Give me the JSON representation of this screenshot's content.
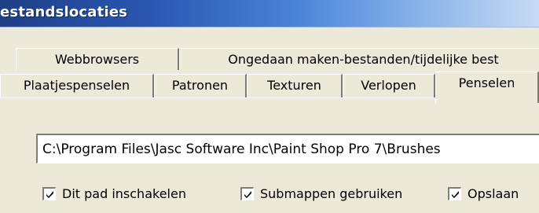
{
  "window": {
    "title": "estandslocaties"
  },
  "tabs_row_1": [
    {
      "label": "Webbrowsers"
    },
    {
      "label": "Ongedaan maken-bestanden/tijdelijke best"
    }
  ],
  "tabs_row_2": [
    {
      "label": "Plaatjespenselen"
    },
    {
      "label": "Patronen"
    },
    {
      "label": "Texturen"
    },
    {
      "label": "Verlopen"
    },
    {
      "label": "Penselen",
      "active": true
    }
  ],
  "path_field": {
    "value": "C:\\Program Files\\Jasc Software Inc\\Paint Shop Pro 7\\Brushes"
  },
  "checkboxes": [
    {
      "label": "Dit pad inschakelen",
      "checked": true,
      "icon": "checkmark-icon"
    },
    {
      "label": "Submappen gebruiken",
      "checked": true,
      "icon": "checkmark-icon"
    },
    {
      "label": "Opslaan",
      "checked": true,
      "icon": "checkmark-icon"
    }
  ]
}
